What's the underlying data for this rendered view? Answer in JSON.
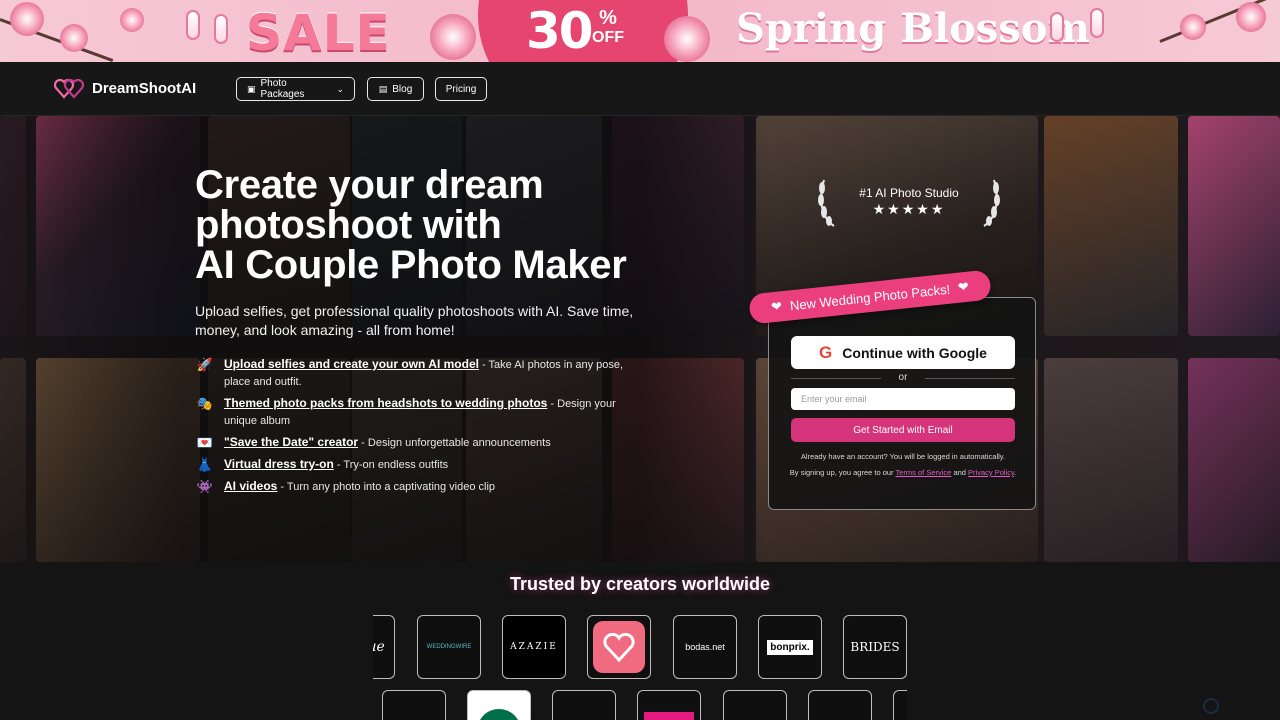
{
  "banner": {
    "sale_text": "SALE",
    "discount_number": "30",
    "discount_percent": "%",
    "discount_off": "OFF",
    "campaign": "Spring Blossom"
  },
  "header": {
    "logo_text": "DreamShootAI",
    "nav": {
      "packages": "Photo Packages",
      "blog": "Blog",
      "pricing": "Pricing"
    }
  },
  "hero": {
    "title_line1": "Create your dream",
    "title_line2": "photoshoot with",
    "title_line3": "AI Couple Photo Maker",
    "subtitle": "Upload selfies, get professional quality photoshoots with AI. Save time, money, and look amazing - all from home!",
    "features": [
      {
        "icon": "rocket-icon",
        "link": "Upload selfies and create your own AI model",
        "desc": " - Take AI photos in any pose, place and outfit."
      },
      {
        "icon": "theater-masks-icon",
        "link": "Themed photo packs from headshots to wedding photos",
        "desc": " - Design your unique album"
      },
      {
        "icon": "love-letter-icon",
        "link": "\"Save the Date\" creator",
        "desc": " - Design unforgettable announcements"
      },
      {
        "icon": "dress-icon",
        "link": "Virtual dress try-on",
        "desc": " - Try-on endless outfits"
      },
      {
        "icon": "video-icon",
        "link": "AI videos",
        "desc": " - Turn any photo into a captivating video clip"
      }
    ],
    "award": {
      "title": "#1 AI Photo Studio",
      "stars": "★★★★★"
    }
  },
  "signup": {
    "ribbon": "New Wedding Photo Packs!",
    "google_button": "Continue with Google",
    "or": "or",
    "email_placeholder": "Enter your email",
    "email_button": "Get Started with Email",
    "note": "Already have an account? You will be logged in automatically.",
    "terms_prefix": "By signing up, you agree to our ",
    "terms_link": "Terms of Service",
    "terms_and": " and ",
    "privacy_link": "Privacy Policy",
    "terms_suffix": "."
  },
  "trusted": {
    "heading": "Trusted by creators worldwide",
    "logos_row1": [
      "Vogue",
      "WEDDINGWIRE",
      "AZAZIE",
      "heart-app",
      "bodas.net",
      "bonprix.",
      "BRIDES"
    ],
    "logos_row2": [
      "",
      "Starbucks",
      "",
      "",
      "",
      "",
      ""
    ]
  },
  "colors": {
    "accent_pink": "#e5456e",
    "cta_pink": "#d5347a",
    "background": "#141414"
  }
}
